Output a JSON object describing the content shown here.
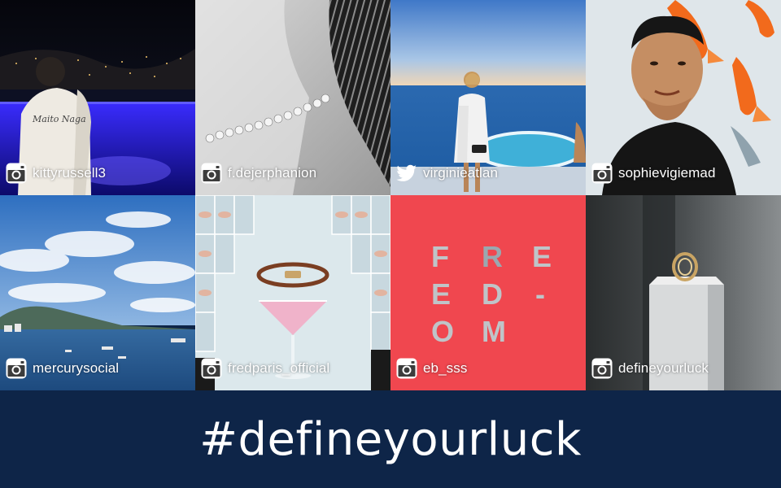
{
  "tiles": [
    {
      "handle": "kittyrussell3",
      "source": "instagram-icon"
    },
    {
      "handle": "f.dejerphanion",
      "source": "instagram-icon"
    },
    {
      "handle": "virginieatlan",
      "source": "twitter-icon"
    },
    {
      "handle": "sophievigiemad",
      "source": "instagram-icon"
    },
    {
      "handle": "mercurysocial",
      "source": "instagram-icon"
    },
    {
      "handle": "fredparis_official",
      "source": "instagram-icon"
    },
    {
      "handle": "eb_sss",
      "source": "instagram-icon"
    },
    {
      "handle": "defineyourluck",
      "source": "instagram-icon"
    }
  ],
  "freedom_letters": [
    "F",
    "R",
    "E",
    "E",
    "D",
    "-",
    "O",
    "M"
  ],
  "banner": {
    "hashtag": "#defineyourluck"
  },
  "colors": {
    "banner_bg": "#0e2548",
    "freedom_red": "#f0474f",
    "handle_text": "#ffffff"
  }
}
